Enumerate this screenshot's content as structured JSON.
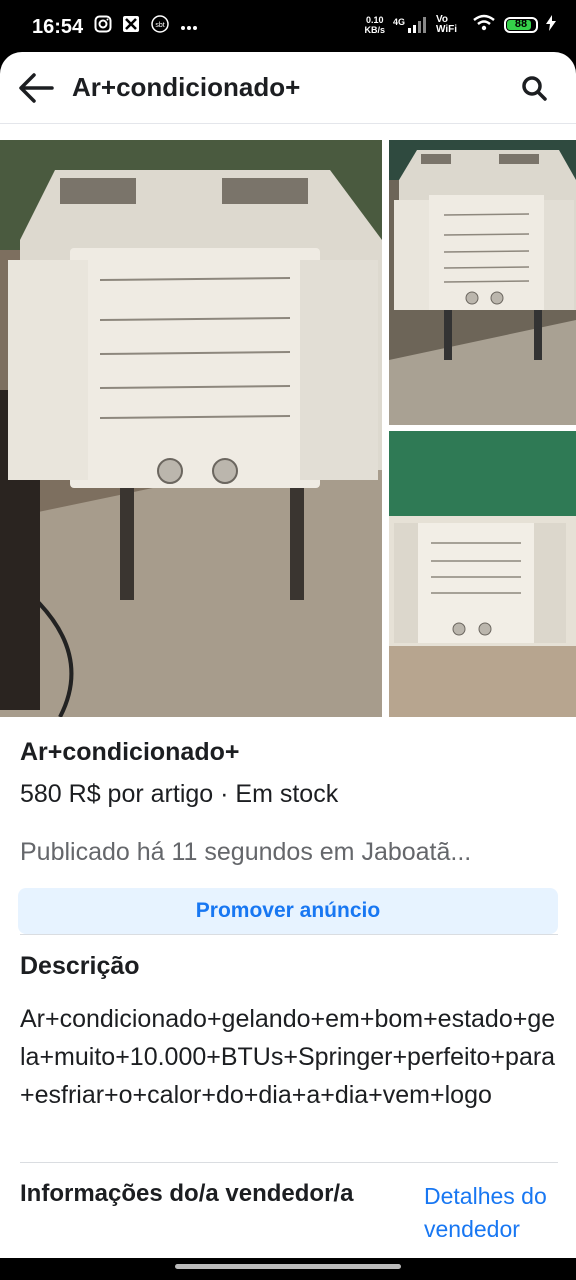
{
  "status_bar": {
    "time": "16:54",
    "left_icons": [
      "instagram-icon",
      "game-icon",
      "sbt-icon",
      "more-icon"
    ],
    "net_speed_value": "0.10",
    "net_speed_unit": "KB/s",
    "network": "4G",
    "vowifi": "Vo WiFi",
    "battery": "88",
    "battery_level": 0.88
  },
  "topbar": {
    "title": "Ar+condicionado+"
  },
  "listing": {
    "title": "Ar+condicionado+",
    "price_line": "580 R$ por artigo · Em stock",
    "published": "Publicado há 11 segundos em Jaboatã..."
  },
  "actions": {
    "promote": "Promover anúncio"
  },
  "description": {
    "heading": "Descrição",
    "text": "Ar+condicionado+gelando+em+bom+estado+gela+muito+10.000+BTUs+Springer+perfeito+para+esfriar+o+calor+do+dia+a+dia+vem+logo"
  },
  "seller": {
    "heading": "Informações do/a vendedor/a",
    "details_link": "Detalhes do vendedor"
  },
  "colors": {
    "accent": "#1877f2",
    "promote_bg": "#e7f3ff",
    "muted_text": "#65676b"
  }
}
